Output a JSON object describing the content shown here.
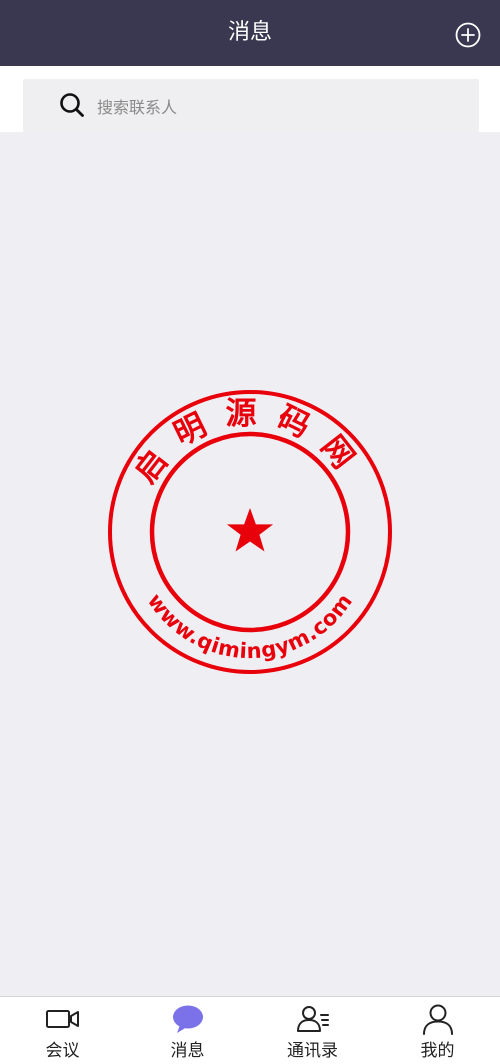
{
  "header": {
    "title": "消息",
    "add_icon": "plus-circle-icon"
  },
  "search": {
    "placeholder": "搜索联系人",
    "value": "",
    "icon": "search-icon"
  },
  "watermark": {
    "top_text": "启明源码网",
    "bottom_text": "www.qimingym.com",
    "color": "#e8000b",
    "icon": "star-icon"
  },
  "tabs": [
    {
      "label": "会议",
      "icon": "video-camera-icon",
      "active": false
    },
    {
      "label": "消息",
      "icon": "chat-bubble-icon",
      "active": true
    },
    {
      "label": "通讯录",
      "icon": "contacts-icon",
      "active": false
    },
    {
      "label": "我的",
      "icon": "person-icon",
      "active": false
    }
  ],
  "colors": {
    "header_bg": "#393850",
    "active_tab": "#7b72ea",
    "page_bg": "#efeef3"
  }
}
